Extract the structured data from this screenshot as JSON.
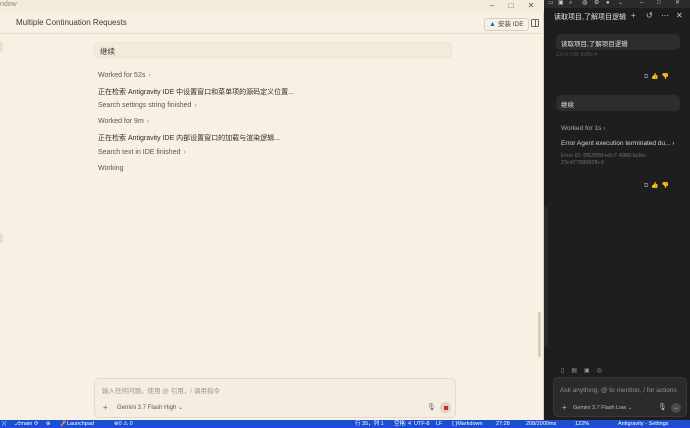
{
  "window": {
    "title_fragment": "ndow"
  },
  "header": {
    "title": "Multiple Continuation Requests",
    "install_label": "安装 IDE"
  },
  "chat": {
    "user_message": "继续",
    "worked_1": "Worked for 52s",
    "step_1": "正在检索 Antigravity IDE 中设置窗口和菜单项的源码定义位置...",
    "search_1": "Search settings string finished",
    "worked_2": "Worked for 9m",
    "step_2": "正在检索 Antigravity IDE 内部设置窗口的加载与渲染逻辑...",
    "search_2": "Search text in IDE finished",
    "working": "Working"
  },
  "composer": {
    "placeholder": "输入任何问题。使用 @ 引用，/ 调用指令",
    "model": "Gemini 3.7 Flash High"
  },
  "side": {
    "title": "读取项目,了解项目逻辑",
    "msg_1": "读取项目,了解项目逻辑",
    "faded_id": "23c4-7d8 8c8b-4",
    "msg_2": "继续",
    "worked": "Worked for 1s",
    "error": "Error Agent execution terminated du...",
    "error_id_1": "Error ID: 8f535f9f-e0c7-4988-bc8e-",
    "error_id_2": "23c47788882fb-9",
    "input_placeholder": "Ask anything, @ to mention, / for actions",
    "model": "Gemini 3.7 Flash Low"
  },
  "statusbar": {
    "branch": "main",
    "launchpad": "Launchpad",
    "problems": "0 ⚠ 0",
    "position": "行 35，列 1",
    "spaces": "空格: 4",
    "encoding": "UTF-8",
    "eol": "LF",
    "language": "Markdown",
    "time": "27:28",
    "chars": "208/2000ms",
    "percent": "122%",
    "app": "Antigravity - Settings"
  }
}
